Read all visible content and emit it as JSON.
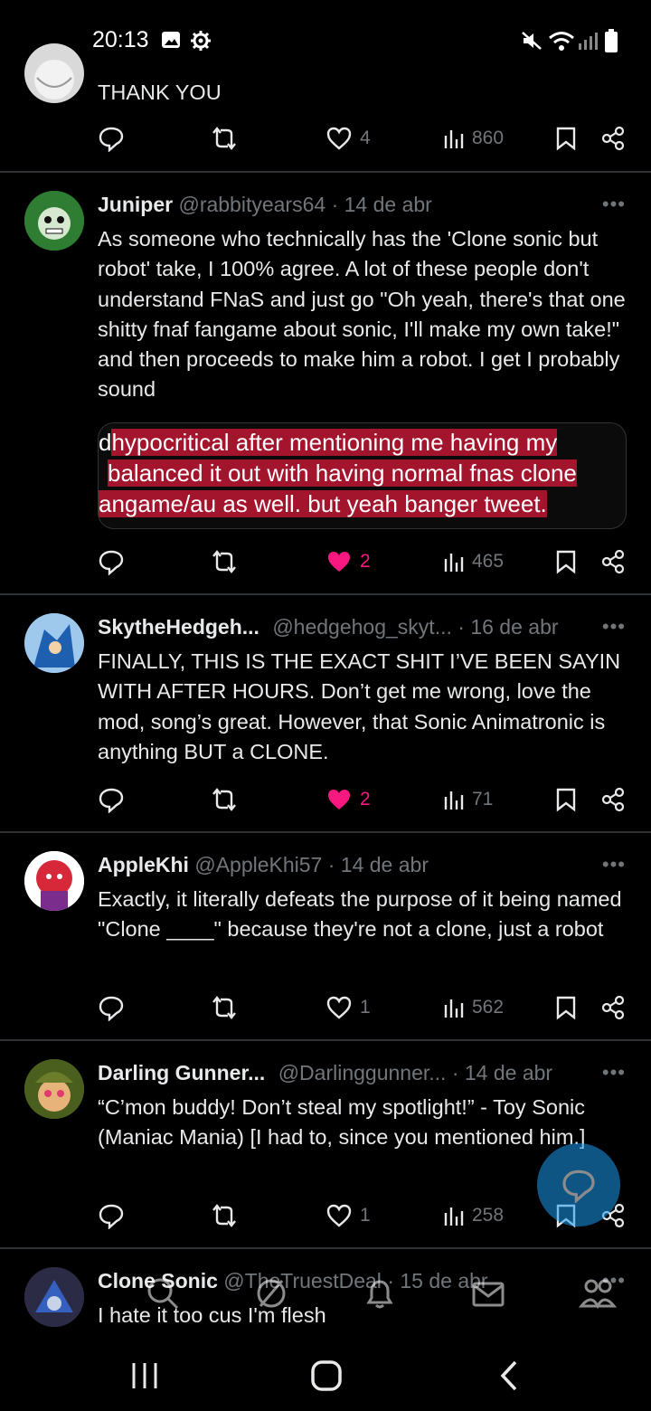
{
  "status": {
    "time": "20:13",
    "icons": [
      "gallery-icon",
      "settings-gear-icon",
      "mute-icon",
      "wifi-icon",
      "signal-icon",
      "battery-icon"
    ]
  },
  "tweets": [
    {
      "text": "THANK YOU",
      "likes": "4",
      "views": "860",
      "liked": false
    },
    {
      "name": "Juniper",
      "handle": "@rabbityears64",
      "date": "14 de abr",
      "text": "As someone who technically has the 'Clone sonic but robot' take, I 100% agree. A lot of these people don't understand FNaS and just go \"Oh yeah, there's that one shitty fnaf fangame about sonic, I'll make my own take!\" and then proceeds to make him a robot. I get I probably sound",
      "media": {
        "line1": "hypocritical after mentioning me having my",
        "line1_prefix": "d",
        "line2": "balanced it out with having normal fnas clone",
        "line3": "angame/au as well. but yeah banger tweet."
      },
      "likes": "2",
      "views": "465",
      "liked": true
    },
    {
      "name": "SkytheHedgeh...",
      "handle": "@hedgehog_skyt...",
      "date": "16 de abr",
      "text": "FINALLY, THIS IS THE EXACT SHIT I’VE BEEN SAYIN WITH AFTER HOURS. Don’t get me wrong, love the mod, song’s great. However, that Sonic Animatronic is anything BUT a CLONE.",
      "likes": "2",
      "views": "71",
      "liked": true
    },
    {
      "name": "AppleKhi",
      "handle": "@AppleKhi57",
      "date": "14 de abr",
      "text": "Exactly, it literally defeats the purpose of it being named \"Clone ____\" because they're not a clone, just a robot",
      "likes": "1",
      "views": "562",
      "liked": false
    },
    {
      "name": "Darling Gunner...",
      "handle": "@Darlinggunner...",
      "date": "14 de abr",
      "text": "“C’mon buddy! Don’t steal my spotlight!” - Toy Sonic (Maniac Mania) [I had to, since you mentioned him.]",
      "likes": "1",
      "views": "258",
      "liked": false
    },
    {
      "name": "Clone Sonic",
      "handle": "@TheTruestDeal",
      "date": "15 de abr",
      "text": "I hate it too cus I'm flesh"
    }
  ],
  "separator": "·",
  "more_label": "•••",
  "colors": {
    "background": "#000000",
    "text": "#e7e9ea",
    "muted": "#71767b",
    "like": "#f91880",
    "accent": "#1d9bf0",
    "divider": "#2f3336",
    "highlight": "#a3142d"
  }
}
